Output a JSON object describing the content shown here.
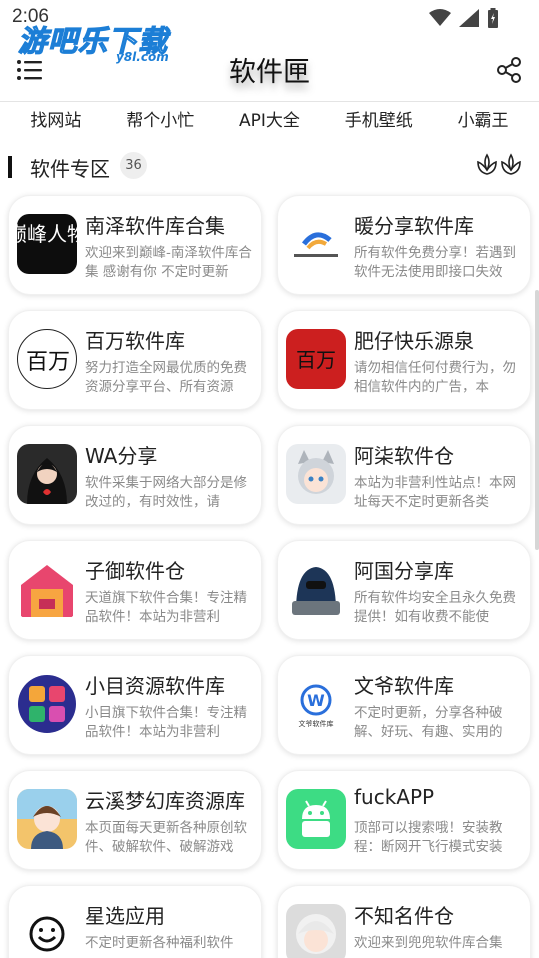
{
  "status_bar": {
    "time": "2:06"
  },
  "brand": {
    "name": "游吧乐下载",
    "domain": "y8l.com"
  },
  "header": {
    "title": "软件匣"
  },
  "nav": {
    "tabs": [
      {
        "label": "找网站"
      },
      {
        "label": "帮个小忙"
      },
      {
        "label": "API大全"
      },
      {
        "label": "手机壁纸"
      },
      {
        "label": "小霸王"
      }
    ]
  },
  "section": {
    "title": "软件专区",
    "count": "36"
  },
  "cards": [
    {
      "title": "南泽软件库合集",
      "desc": "欢迎来到巅峰-南泽软件库合集 感谢有你 不定时更新",
      "icon": "calligraphy-icon",
      "icon_text": "巅峰人物",
      "icon_bg": "#0d0d0d"
    },
    {
      "title": "暖分享软件库",
      "desc": "所有软件免费分享！若遇到软件无法使用即接口失效",
      "icon": "nuan-logo-icon",
      "icon_bg": "#ffffff"
    },
    {
      "title": "百万软件库",
      "desc": "努力打造全网最优质的免费资源分享平台、所有资源",
      "icon": "baiwan-logo-icon",
      "icon_text": "百万",
      "icon_bg": "#ffffff"
    },
    {
      "title": "肥仔快乐源泉",
      "desc": "请勿相信任何付费行为，勿相信软件内的广告，本",
      "icon": "feizai-logo-icon",
      "icon_text": "百万",
      "icon_bg": "#cc1f1f"
    },
    {
      "title": "WA分享",
      "desc": "软件采集于网络大部分是修改过的，有时效性，请",
      "icon": "hoodie-avatar-icon",
      "icon_bg": "#2a2a2a"
    },
    {
      "title": "阿柒软件仓",
      "desc": "本站为非营利性站点！本网址每天不定时更新各类",
      "icon": "anime-cat-girl-icon",
      "icon_bg": "#e9ecef"
    },
    {
      "title": "子御软件仓",
      "desc": "天道旗下软件合集！专注精品软件！本站为非营利",
      "icon": "house-logo-icon",
      "icon_bg": "#ffffff"
    },
    {
      "title": "阿国分享库",
      "desc": "所有软件均安全且永久免费提供！如有收费不能使",
      "icon": "hacker-icon",
      "icon_bg": "#ffffff"
    },
    {
      "title": "小目资源软件库",
      "desc": "小目旗下软件合集！专注精品软件！本站为非营利",
      "icon": "apps-circle-icon",
      "icon_bg": "#ffffff"
    },
    {
      "title": "文爷软件库",
      "desc": "不定时更新，分享各种破解、好玩、有趣、实用的",
      "icon": "wenye-logo-icon",
      "icon_text": "文爷软件库",
      "icon_bg": "#ffffff"
    },
    {
      "title": "云溪梦幻库资源库",
      "desc": "本页面每天更新各种原创软件、破解软件、破解游戏",
      "icon": "anime-boy-icon",
      "icon_bg": "#f3c46b"
    },
    {
      "title": "fuckAPP",
      "desc": "顶部可以搜索哦！安装教程：断网开飞行模式安装",
      "icon": "android-icon",
      "icon_bg": "#3ddc84"
    },
    {
      "title": "星选应用",
      "desc": "不定时更新各种福利软件",
      "icon": "smiley-icon",
      "icon_bg": "#ffffff"
    },
    {
      "title": "不知名件仓",
      "desc": "欢迎来到兜兜软件库合集",
      "icon": "anime-white-hair-icon",
      "icon_bg": "#dcdcdc"
    }
  ],
  "colors": {
    "accent": "#1c7ed6",
    "android_green": "#3ddc84"
  }
}
